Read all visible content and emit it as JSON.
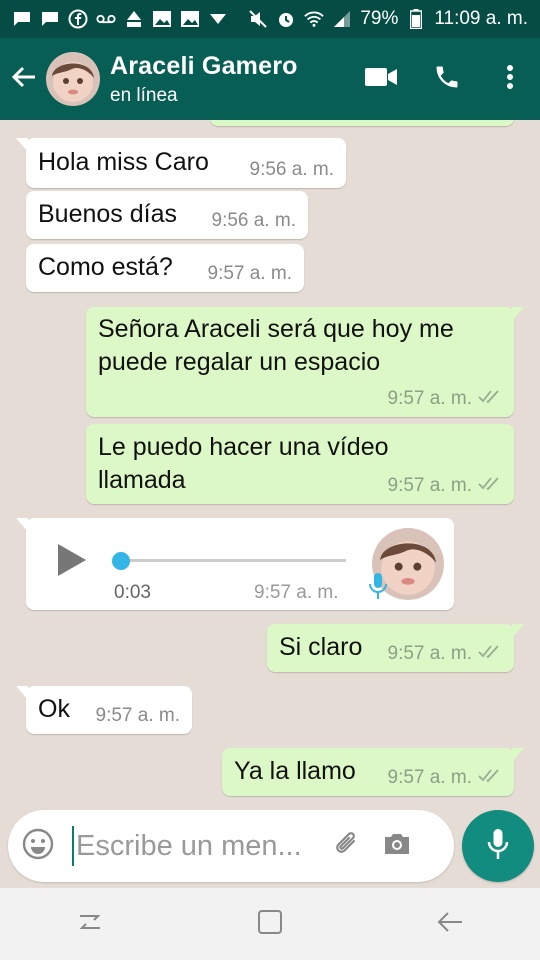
{
  "status_bar": {
    "battery": "79%",
    "time": "11:09 a. m."
  },
  "header": {
    "contact_name": "Araceli Gamero",
    "contact_status": "en línea",
    "icons": [
      "back-arrow-icon",
      "video-call-icon",
      "phone-call-icon",
      "more-vert-icon"
    ]
  },
  "messages": [
    {
      "direction": "in",
      "text": "Hola miss Caro",
      "time": "9:56 a. m."
    },
    {
      "direction": "in",
      "text": "Buenos días",
      "time": "9:56 a. m."
    },
    {
      "direction": "in",
      "text": "Como está?",
      "time": "9:57 a. m."
    },
    {
      "direction": "out",
      "text": "Señora Araceli será que hoy me puede regalar un espacio",
      "time": "9:57 a. m.",
      "status": "read"
    },
    {
      "direction": "out",
      "text": "Le puedo hacer una vídeo llamada",
      "time": "9:57 a. m.",
      "status": "read"
    },
    {
      "direction": "in",
      "type": "voice",
      "duration": "0:03",
      "time": "9:57 a. m.",
      "progress": 0.0
    },
    {
      "direction": "out",
      "text": "Si claro",
      "time": "9:57 a. m.",
      "status": "read"
    },
    {
      "direction": "in",
      "text": "Ok",
      "time": "9:57 a. m."
    },
    {
      "direction": "out",
      "text": "Ya la llamo",
      "time": "9:57 a. m.",
      "status": "read"
    }
  ],
  "input": {
    "placeholder": "Escribe un men..."
  },
  "colors": {
    "header": "#075e54",
    "status_bar": "#054d44",
    "chat_bg": "#e5ddd5",
    "incoming": "#ffffff",
    "outgoing": "#dcf8c6",
    "accent": "#128c7e",
    "voice_knob": "#33b5e5"
  }
}
